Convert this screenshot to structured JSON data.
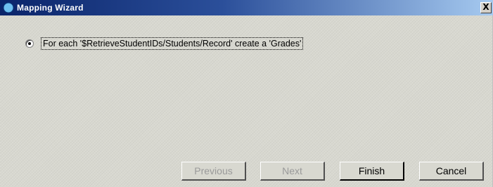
{
  "window": {
    "title": "Mapping Wizard",
    "close_glyph": "X",
    "icon": "compass-icon"
  },
  "option": {
    "label": "For each '$RetrieveStudentIDs/Students/Record' create a 'Grades'",
    "selected": true
  },
  "buttons": {
    "previous": "Previous",
    "next": "Next",
    "finish": "Finish",
    "cancel": "Cancel"
  },
  "colors": {
    "title_start": "#0a246a",
    "title_end": "#a6caf0",
    "dialog_bg": "#d8d8d0",
    "disabled_text": "#9a9a9a"
  }
}
